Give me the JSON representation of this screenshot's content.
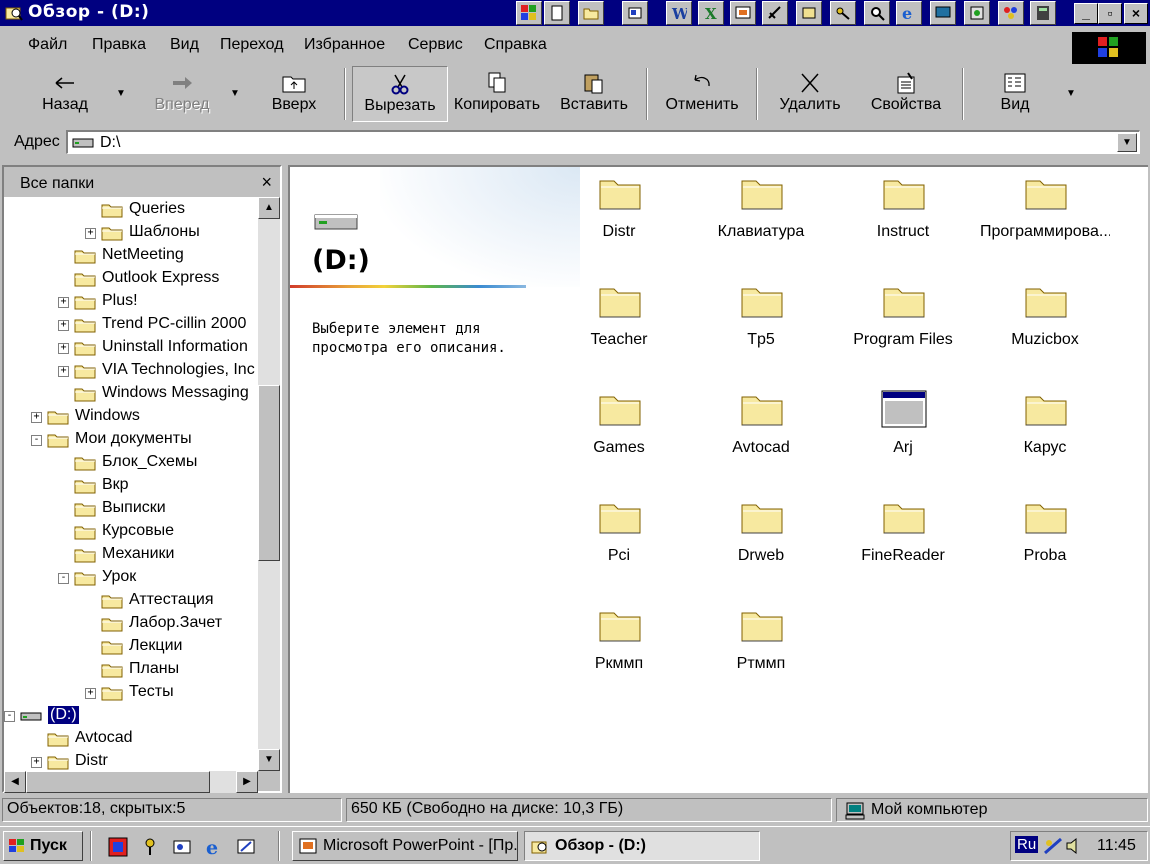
{
  "window": {
    "title": "Обзор -  (D:)",
    "minimize": "_",
    "restore": "▫",
    "close": "×"
  },
  "menu": [
    {
      "label": "Файл"
    },
    {
      "label": "Правка"
    },
    {
      "label": "Вид"
    },
    {
      "label": "Переход"
    },
    {
      "label": "Избранное"
    },
    {
      "label": "Сервис"
    },
    {
      "label": "Справка"
    }
  ],
  "toolbar": {
    "back": "Назад",
    "forward": "Вперед",
    "up": "Вверх",
    "cut": "Вырезать",
    "copy": "Копировать",
    "paste": "Вставить",
    "undo": "Отменить",
    "delete": "Удалить",
    "properties": "Свойства",
    "view": "Вид"
  },
  "address": {
    "label": "Адрес",
    "value": "D:\\"
  },
  "folders_pane": {
    "title": "Все папки",
    "tree": [
      {
        "label": "Queries",
        "level": 3,
        "expander": ""
      },
      {
        "label": "Шаблоны",
        "level": 3,
        "expander": "+"
      },
      {
        "label": "NetMeeting",
        "level": 2,
        "expander": ""
      },
      {
        "label": "Outlook Express",
        "level": 2,
        "expander": ""
      },
      {
        "label": "Plus!",
        "level": 2,
        "expander": "+"
      },
      {
        "label": "Trend PC-cillin 2000",
        "level": 2,
        "expander": "+"
      },
      {
        "label": "Uninstall Information",
        "level": 2,
        "expander": "+"
      },
      {
        "label": "VIA Technologies, Inc",
        "level": 2,
        "expander": "+"
      },
      {
        "label": "Windows Messaging",
        "level": 2,
        "expander": ""
      },
      {
        "label": "Windows",
        "level": 1,
        "expander": "+"
      },
      {
        "label": "Мои документы",
        "level": 1,
        "expander": "-"
      },
      {
        "label": "Блок_Схемы",
        "level": 2,
        "expander": ""
      },
      {
        "label": "Вкр",
        "level": 2,
        "expander": ""
      },
      {
        "label": "Выписки",
        "level": 2,
        "expander": ""
      },
      {
        "label": "Курсовые",
        "level": 2,
        "expander": ""
      },
      {
        "label": "Механики",
        "level": 2,
        "expander": ""
      },
      {
        "label": "Урок",
        "level": 2,
        "expander": "-"
      },
      {
        "label": "Аттестация",
        "level": 3,
        "expander": ""
      },
      {
        "label": "Лабор.Зачет",
        "level": 3,
        "expander": ""
      },
      {
        "label": "Лекции",
        "level": 3,
        "expander": ""
      },
      {
        "label": "Планы",
        "level": 3,
        "expander": ""
      },
      {
        "label": "Тесты",
        "level": 3,
        "expander": "+"
      },
      {
        "label": "(D:)",
        "level": 0,
        "expander": "-",
        "selected": true,
        "drive": true
      },
      {
        "label": "Avtocad",
        "level": 1,
        "expander": ""
      },
      {
        "label": "Distr",
        "level": 1,
        "expander": "+"
      }
    ]
  },
  "content": {
    "drive_title": "(D:)",
    "description": "Выберите элемент для просмотра его описания.",
    "items": [
      {
        "name": "Distr",
        "icon": "folder-icon"
      },
      {
        "name": "Клавиатура",
        "icon": "folder-icon"
      },
      {
        "name": "Instruct",
        "icon": "folder-icon"
      },
      {
        "name": "Программирова...",
        "icon": "folder-icon"
      },
      {
        "name": "Teacher",
        "icon": "folder-icon"
      },
      {
        "name": "Tp5",
        "icon": "folder-icon"
      },
      {
        "name": "Program Files",
        "icon": "folder-icon"
      },
      {
        "name": "Muzicbox",
        "icon": "folder-icon"
      },
      {
        "name": "Games",
        "icon": "folder-icon"
      },
      {
        "name": "Avtocad",
        "icon": "folder-icon"
      },
      {
        "name": "Arj",
        "icon": "program-window-icon"
      },
      {
        "name": "Карус",
        "icon": "folder-icon"
      },
      {
        "name": "Pci",
        "icon": "folder-icon"
      },
      {
        "name": "Drweb",
        "icon": "folder-icon"
      },
      {
        "name": "FineReader",
        "icon": "folder-icon"
      },
      {
        "name": "Proba",
        "icon": "folder-icon"
      },
      {
        "name": "Ркммп",
        "icon": "folder-icon"
      },
      {
        "name": "Ртммп",
        "icon": "folder-icon"
      }
    ]
  },
  "status": {
    "objects": "Объектов:18, скрытых:5",
    "size": "650 КБ (Свободно на диске: 10,3 ГБ)",
    "zone": "Мой компьютер"
  },
  "taskbar": {
    "start": "Пуск",
    "tasks": [
      "Microsoft PowerPoint - [Пр...",
      "Обзор -  (D:)"
    ],
    "lang": "Ru",
    "clock": "11:45"
  },
  "colors": {
    "titlebar": "#000080",
    "face": "#c0c0c0",
    "folder": "#f7e9a0",
    "selection": "#000080"
  }
}
